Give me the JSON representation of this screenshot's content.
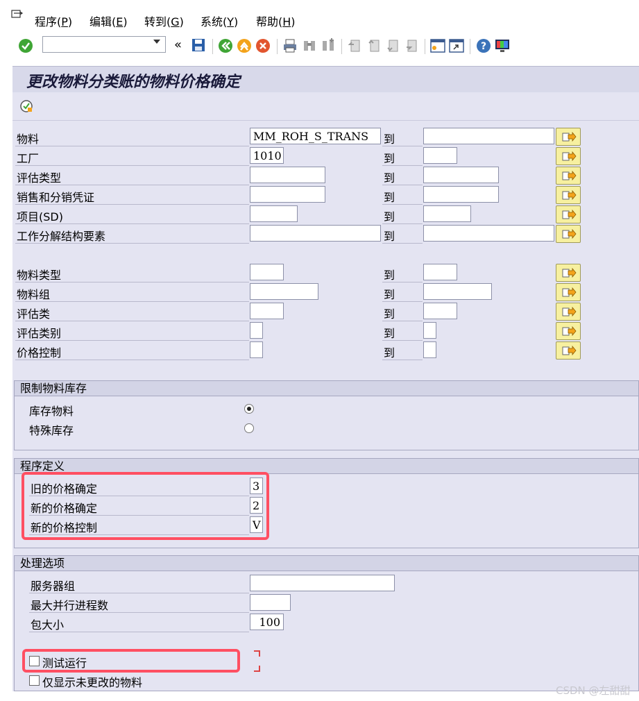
{
  "menu": {
    "items": [
      {
        "label": "程序(",
        "key": "P",
        "end": ")"
      },
      {
        "label": "编辑(",
        "key": "E",
        "end": ")"
      },
      {
        "label": "转到(",
        "key": "G",
        "end": ")"
      },
      {
        "label": "系统(",
        "key": "Y",
        "end": ")"
      },
      {
        "label": "帮助(",
        "key": "H",
        "end": ")"
      }
    ]
  },
  "toolbar": {
    "command_value": "",
    "back_label": "«"
  },
  "title": "更改物料分类账的物料价格确定",
  "selection": {
    "to_label": "到",
    "rows": [
      {
        "label": "物料",
        "from": "MM_ROH_S_TRANS",
        "to": ""
      },
      {
        "label": "工厂",
        "from": "1010",
        "to": ""
      },
      {
        "label": "评估类型",
        "from": "",
        "to": ""
      },
      {
        "label": "销售和分销凭证",
        "from": "",
        "to": ""
      },
      {
        "label": "项目(SD)",
        "from": "",
        "to": ""
      },
      {
        "label": "工作分解结构要素",
        "from": "",
        "to": ""
      },
      {
        "label": "物料类型",
        "from": "",
        "to": ""
      },
      {
        "label": "物料组",
        "from": "",
        "to": ""
      },
      {
        "label": "评估类",
        "from": "",
        "to": ""
      },
      {
        "label": "评估类别",
        "from": "",
        "to": ""
      },
      {
        "label": "价格控制",
        "from": "",
        "to": ""
      }
    ]
  },
  "stock_group": {
    "title": "限制物料库存",
    "options": [
      {
        "label": "库存物料",
        "selected": true
      },
      {
        "label": "特殊库存",
        "selected": false
      }
    ]
  },
  "program_group": {
    "title": "程序定义",
    "rows": [
      {
        "label": "旧的价格确定",
        "value": "3"
      },
      {
        "label": "新的价格确定",
        "value": "2"
      },
      {
        "label": "新的价格控制",
        "value": "V"
      }
    ]
  },
  "processing_group": {
    "title": "处理选项",
    "rows": [
      {
        "label": "服务器组",
        "value": ""
      },
      {
        "label": "最大并行进程数",
        "value": ""
      },
      {
        "label": "包大小",
        "value": "100"
      }
    ],
    "checkboxes": [
      {
        "label": "测试运行",
        "checked": false
      },
      {
        "label": "仅显示未更改的物料",
        "checked": false
      }
    ]
  },
  "watermark": "CSDN @左甜甜",
  "colors": {
    "highlight": "#ff4f62",
    "panel_bg": "#e4e4f2",
    "title_bg": "#d8d9ea",
    "multi_button": "#f7f0a0"
  }
}
